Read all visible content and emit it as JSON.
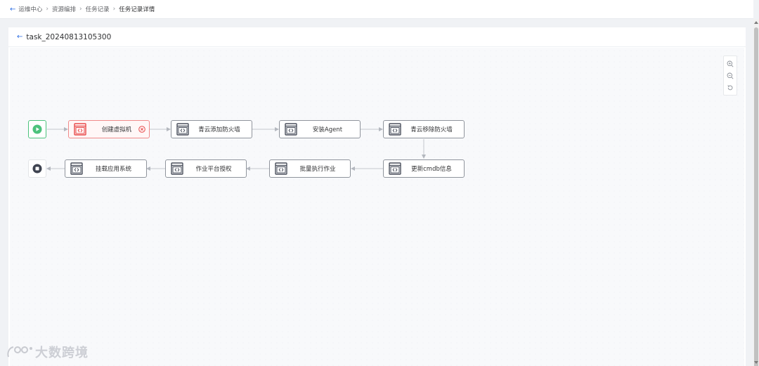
{
  "breadcrumb": {
    "items": [
      {
        "label": "运维中心"
      },
      {
        "label": "资源编排"
      },
      {
        "label": "任务记录"
      },
      {
        "label": "任务记录详情"
      }
    ]
  },
  "task": {
    "title": "task_20240813105300"
  },
  "flow": {
    "start": {
      "status": "start"
    },
    "end": {
      "status": "end"
    },
    "nodes": [
      {
        "label": "创建虚拟机",
        "status": "error"
      },
      {
        "label": "青云添加防火墙",
        "status": "normal"
      },
      {
        "label": "安装Agent",
        "status": "normal"
      },
      {
        "label": "青云移除防火墙",
        "status": "normal"
      },
      {
        "label": "更新cmdb信息",
        "status": "normal"
      },
      {
        "label": "批量执行作业",
        "status": "normal"
      },
      {
        "label": "作业平台授权",
        "status": "normal"
      },
      {
        "label": "挂载应用系统",
        "status": "normal"
      }
    ]
  },
  "zoom_tools": {
    "icons": [
      "zoom-in-icon",
      "zoom-out-icon",
      "reset-icon"
    ]
  },
  "watermark": {
    "text": "大数跨境"
  },
  "colors": {
    "accent": "#2f6fe4",
    "error": "#e84a4a",
    "success": "#4cc27c",
    "node_border": "#8f949c",
    "icon_dark": "#4a4f5c"
  }
}
